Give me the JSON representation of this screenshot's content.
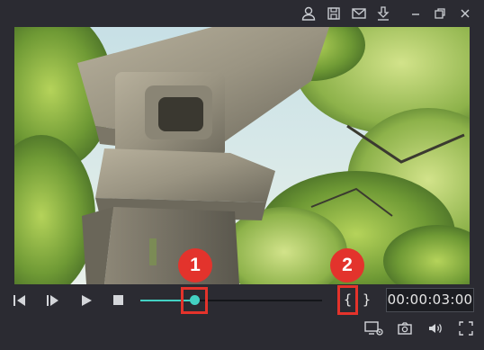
{
  "titlebar": {
    "icons": [
      "account-icon",
      "save-icon",
      "mail-icon",
      "download-icon",
      "minimize-icon",
      "restore-icon",
      "close-icon"
    ]
  },
  "player": {
    "progress": 0.3,
    "mark_in_label": "{",
    "mark_out_label": "}",
    "timecode": "00:00:03:00",
    "accent_color": "#43d1c3"
  },
  "callouts": {
    "badge_1": "1",
    "badge_2": "2",
    "color": "#e4332b"
  },
  "bottom_icons": [
    "display-settings-icon",
    "snapshot-camera-icon",
    "volume-icon",
    "fullscreen-icon"
  ]
}
